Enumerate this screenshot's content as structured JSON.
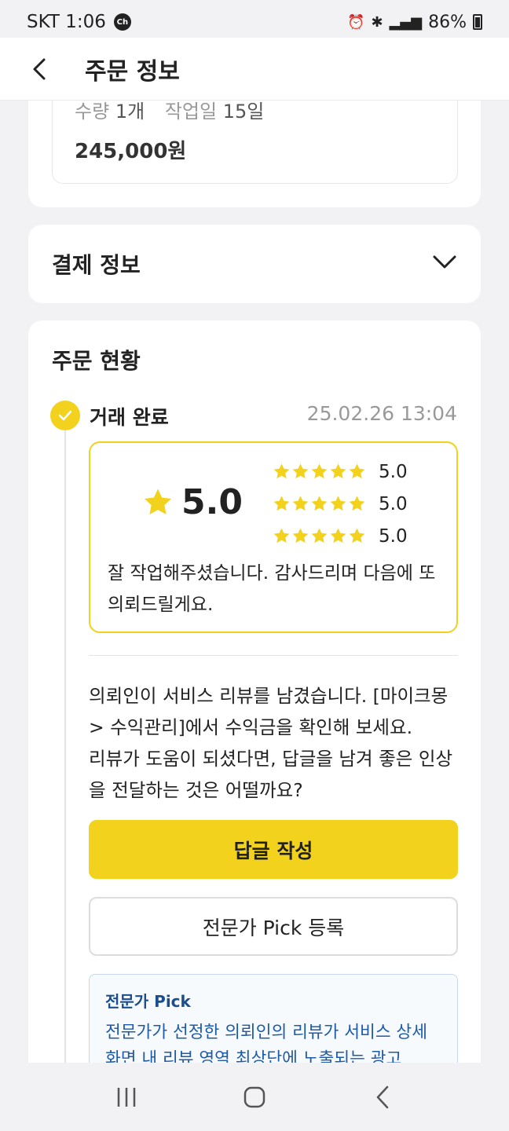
{
  "status_bar": {
    "carrier_time": "SKT 1:06",
    "chat_badge": "Ch",
    "battery": "86%"
  },
  "header": {
    "title": "주문 정보"
  },
  "order_card": {
    "qty_label": "수량",
    "qty_value": "1개",
    "work_label": "작업일",
    "work_value": "15일",
    "price": "245,000원"
  },
  "payment": {
    "label": "결제 정보"
  },
  "order_status": {
    "title": "주문 현황",
    "step_label": "거래 완료",
    "step_date": "25.02.26 13:04",
    "review": {
      "overall": "5.0",
      "rows": [
        {
          "stars": 5,
          "value": "5.0"
        },
        {
          "stars": 5,
          "value": "5.0"
        },
        {
          "stars": 5,
          "value": "5.0"
        }
      ],
      "text": "잘 작업해주셨습니다. 감사드리며 다음에 또 의뢰드릴게요."
    },
    "notice": "의뢰인이 서비스 리뷰를 남겼습니다. [마이크몽> 수익관리]에서 수익금을 확인해 보세요.\n 리뷰가 도움이 되셨다면, 답글을 남겨 좋은 인상을 전달하는 것은 어떨까요?",
    "reply_button": "답글 작성",
    "pick_button": "전문가 Pick 등록",
    "info": {
      "title": "전문가 Pick",
      "text": "전문가가 선정한 의뢰인의 리뷰가 서비스 상세 화면 내 리뷰 영역 최상단에 노출되는 광고"
    }
  },
  "colors": {
    "accent": "#f2d21c",
    "info_text": "#1f5aa6"
  },
  "icons": [
    "back-arrow-icon",
    "chevron-down-icon",
    "check-icon",
    "star-icon",
    "recent-apps-icon",
    "home-icon",
    "nav-back-icon"
  ]
}
